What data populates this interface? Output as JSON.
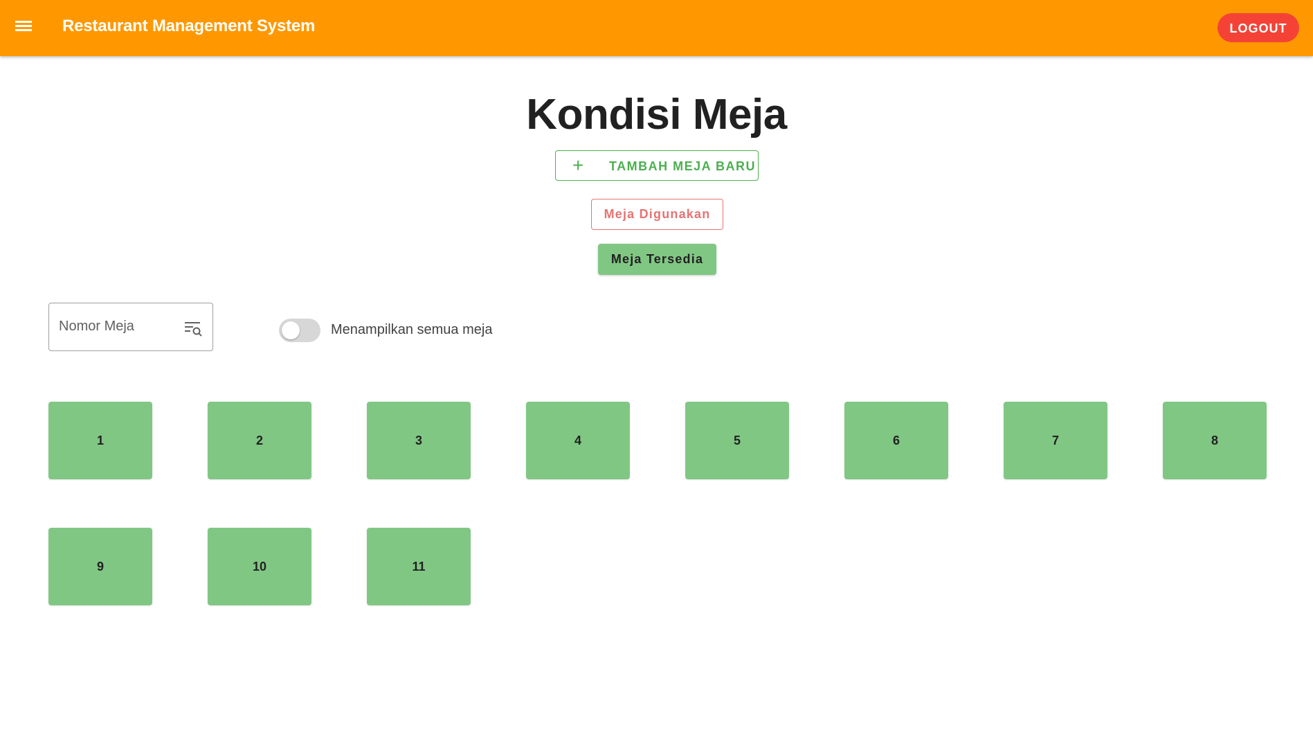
{
  "header": {
    "title": "Restaurant Management System",
    "logout_label": "LOGOUT",
    "background_color": "#ff9800"
  },
  "main": {
    "title": "Kondisi Meja",
    "add_button_label": "TAMBAH MEJA BARU",
    "add_icon_glyph": "+",
    "used_filter_label": "Meja Digunakan",
    "available_filter_label": "Meja Tersedia",
    "search": {
      "placeholder": "Nomor Meja",
      "value": ""
    },
    "show_all_toggle": {
      "label": "Menampilkan semua meja",
      "checked": false
    },
    "tables": [
      "1",
      "2",
      "3",
      "4",
      "5",
      "6",
      "7",
      "8",
      "9",
      "10",
      "11"
    ],
    "tile_color": "#81c784"
  }
}
